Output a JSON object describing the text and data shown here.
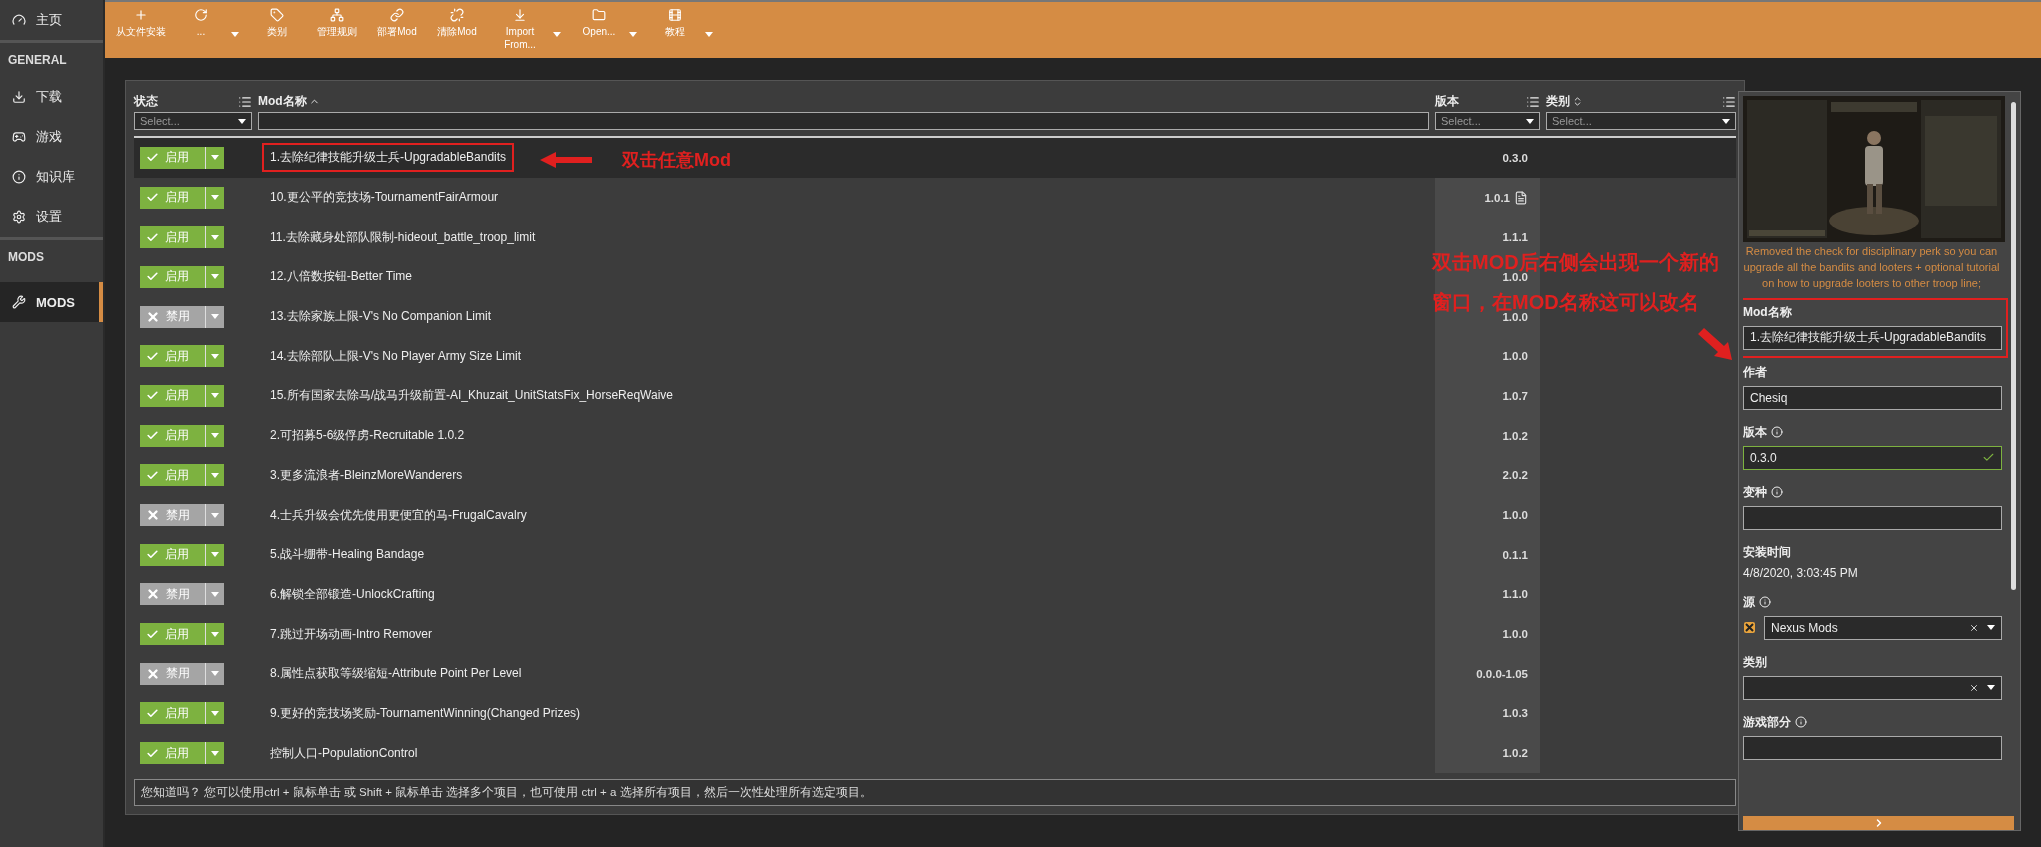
{
  "sidebar": {
    "items": [
      {
        "kind": "item",
        "label": "主页",
        "selected": false
      },
      {
        "kind": "heading",
        "label": "GENERAL"
      },
      {
        "kind": "item",
        "label": "下载",
        "selected": false
      },
      {
        "kind": "item",
        "label": "游戏",
        "selected": false
      },
      {
        "kind": "item",
        "label": "知识库",
        "selected": false
      },
      {
        "kind": "item",
        "label": "设置",
        "selected": false
      },
      {
        "kind": "heading",
        "label": "MODS"
      },
      {
        "kind": "item",
        "label": "MODS",
        "selected": true
      }
    ]
  },
  "toolbar": [
    {
      "label": "从文件安装",
      "dropdown": false
    },
    {
      "label": "...",
      "dropdown": true
    },
    {
      "label": "类别",
      "dropdown": false
    },
    {
      "label": "管理规则",
      "dropdown": false
    },
    {
      "label": "部署Mod",
      "dropdown": false
    },
    {
      "label": "清除Mod",
      "dropdown": false
    },
    {
      "label": "Import From...",
      "dropdown": true
    },
    {
      "label": "Open...",
      "dropdown": true
    },
    {
      "label": "教程",
      "dropdown": true
    }
  ],
  "table": {
    "columns": [
      {
        "label": "状态",
        "placeholder": "Select...",
        "sortable": false
      },
      {
        "label": "Mod名称",
        "sortable": true
      },
      {
        "label": "版本",
        "placeholder": "Select...",
        "sortable": false
      },
      {
        "label": "类别",
        "placeholder": "Select...",
        "sortable": true
      }
    ],
    "rows": [
      {
        "enabled": true,
        "status": "启用",
        "name": "1.去除纪律技能升级士兵-UpgradableBandits",
        "version": "0.3.0",
        "selected": true,
        "note": false
      },
      {
        "enabled": true,
        "status": "启用",
        "name": "10.更公平的竞技场-TournamentFairArmour",
        "version": "1.0.1",
        "selected": false,
        "note": true
      },
      {
        "enabled": true,
        "status": "启用",
        "name": "11.去除藏身处部队限制-hideout_battle_troop_limit",
        "version": "1.1.1",
        "selected": false,
        "note": false
      },
      {
        "enabled": true,
        "status": "启用",
        "name": "12.八倍数按钮-Better Time",
        "version": "1.0.0",
        "selected": false,
        "note": false
      },
      {
        "enabled": false,
        "status": "禁用",
        "name": "13.去除家族上限-V's No Companion Limit",
        "version": "1.0.0",
        "selected": false,
        "note": false
      },
      {
        "enabled": true,
        "status": "启用",
        "name": "14.去除部队上限-V's No Player Army Size Limit",
        "version": "1.0.0",
        "selected": false,
        "note": false
      },
      {
        "enabled": true,
        "status": "启用",
        "name": "15.所有国家去除马/战马升级前置-AI_Khuzait_UnitStatsFix_HorseReqWaive",
        "version": "1.0.7",
        "selected": false,
        "note": false
      },
      {
        "enabled": true,
        "status": "启用",
        "name": "2.可招募5-6级俘虏-Recruitable 1.0.2",
        "version": "1.0.2",
        "selected": false,
        "note": false
      },
      {
        "enabled": true,
        "status": "启用",
        "name": "3.更多流浪者-BleinzMoreWanderers",
        "version": "2.0.2",
        "selected": false,
        "note": false
      },
      {
        "enabled": false,
        "status": "禁用",
        "name": "4.士兵升级会优先使用更便宜的马-FrugalCavalry",
        "version": "1.0.0",
        "selected": false,
        "note": false
      },
      {
        "enabled": true,
        "status": "启用",
        "name": "5.战斗绷带-Healing Bandage",
        "version": "0.1.1",
        "selected": false,
        "note": false
      },
      {
        "enabled": false,
        "status": "禁用",
        "name": "6.解锁全部锻造-UnlockCrafting",
        "version": "1.1.0",
        "selected": false,
        "note": false
      },
      {
        "enabled": true,
        "status": "启用",
        "name": "7.跳过开场动画-Intro Remover",
        "version": "1.0.0",
        "selected": false,
        "note": false
      },
      {
        "enabled": false,
        "status": "禁用",
        "name": "8.属性点获取等级缩短-Attribute Point Per Level",
        "version": "0.0.0-1.05",
        "selected": false,
        "note": false
      },
      {
        "enabled": true,
        "status": "启用",
        "name": "9.更好的竞技场奖励-TournamentWinning(Changed Prizes)",
        "version": "1.0.3",
        "selected": false,
        "note": false
      },
      {
        "enabled": true,
        "status": "启用",
        "name": "控制人口-PopulationControl",
        "version": "1.0.2",
        "selected": false,
        "note": false
      }
    ]
  },
  "hint": "您知道吗？ 您可以使用ctrl + 鼠标单击 或 Shift + 鼠标单击 选择多个项目，也可使用 ctrl + a 选择所有项目，然后一次性处理所有选定项目。",
  "details": {
    "description": "Removed the check for disciplinary perk so you can upgrade all the bandits and looters + optional tutorial on how to upgrade looters to other troop line;",
    "fields": [
      {
        "kind": "input",
        "label": "Mod名称",
        "value": "1.去除纪律技能升级士兵-UpgradableBandits",
        "info": false,
        "valid": false,
        "highlighted": true
      },
      {
        "kind": "input",
        "label": "作者",
        "value": "Chesiq",
        "info": false,
        "valid": false,
        "highlighted": false
      },
      {
        "kind": "input",
        "label": "版本",
        "value": "0.3.0",
        "info": true,
        "valid": true,
        "highlighted": false
      },
      {
        "kind": "input",
        "label": "变种",
        "info": true,
        "valid": false,
        "highlighted": false
      },
      {
        "kind": "text",
        "label": "安装时间",
        "value": "4/8/2020, 3:03:45 PM",
        "info": false
      },
      {
        "kind": "source",
        "label": "源",
        "value": "Nexus Mods",
        "info": true
      },
      {
        "kind": "select",
        "label": "类别",
        "info": false
      },
      {
        "kind": "input",
        "label": "游戏部分",
        "info": true,
        "valid": false,
        "highlighted": false
      }
    ]
  },
  "annotations": {
    "row_note": "双击任意Mod",
    "panel_note": [
      "双击MOD后右侧会出现一个新的",
      "窗口，在MOD名称这可以改名"
    ]
  }
}
